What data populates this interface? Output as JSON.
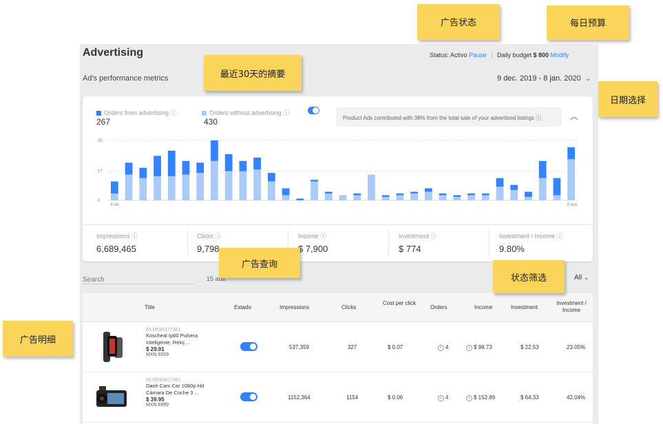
{
  "header": {
    "title": "Advertising",
    "status_label": "Status",
    "status_value": "Activo",
    "pause_link": "Pause",
    "budget_label": "Daily budget",
    "budget_value": "$ 800",
    "modify_link": "Modify"
  },
  "subtitle": "Ad's performance metrics",
  "date_range": {
    "start": "9 dec. 2019",
    "end": "8 jan. 2020"
  },
  "chart_card": {
    "legend": [
      {
        "label": "Orders from advertising",
        "value": "267",
        "color": "#3483fa"
      },
      {
        "label": "Orders without advertising",
        "value": "430",
        "color": "#aacbf7"
      }
    ],
    "info_text": "Product Ads contributed with 38% from the total sale of your advertised listings"
  },
  "chart_data": {
    "type": "bar",
    "stacked": true,
    "y_ticks": [
      "35",
      "17",
      "0"
    ],
    "ylim": [
      0,
      35
    ],
    "x_ticks": [
      "9 dic",
      "8 ene"
    ],
    "series": [
      {
        "name": "Orders from advertising",
        "color": "#3483fa",
        "values": [
          7,
          7,
          6,
          12,
          15,
          8,
          6,
          12,
          10,
          6,
          7,
          5,
          4,
          1,
          1,
          1,
          0,
          1,
          0,
          1,
          1,
          1,
          2,
          1,
          1,
          1,
          1,
          5,
          3,
          3,
          10,
          10,
          7
        ]
      },
      {
        "name": "Orders without advertising",
        "color": "#aacbf7",
        "values": [
          4,
          15,
          13,
          14,
          14,
          15,
          16,
          23,
          17,
          17,
          18,
          11,
          3,
          0,
          11,
          4,
          3,
          3,
          15,
          2,
          3,
          4,
          5,
          3,
          2,
          3,
          3,
          8,
          6,
          2,
          13,
          3,
          24
        ]
      }
    ]
  },
  "metrics": [
    {
      "label": "Impressions",
      "value": "6,689,465"
    },
    {
      "label": "Clicks",
      "value": "9,798"
    },
    {
      "label": "Income",
      "value": "$ 7,900"
    },
    {
      "label": "Investment",
      "value": "$ 774"
    },
    {
      "label": "Investment / Income",
      "value": "9.80%"
    }
  ],
  "search": {
    "placeholder": "Search",
    "result_count": "15 ads"
  },
  "filter": {
    "label": "All"
  },
  "table": {
    "columns": [
      "Title",
      "Estado",
      "Impressions",
      "Clicks",
      "Cost per click",
      "Orders",
      "Income",
      "Investment",
      "Investment / Income"
    ],
    "rows": [
      {
        "id": "MLM580177361",
        "title": "Koscheal Ip60 Pulsera Inteligente, Reloj ...",
        "price": "$ 29.91",
        "currency": "MXN 6559",
        "impressions": "537,359",
        "clicks": "327",
        "cpc": "$ 0.07",
        "orders": "4",
        "income": "$ 98.73",
        "investment": "$ 22.53",
        "ratio": "23.05%"
      },
      {
        "id": "MLM580817361",
        "title": "Dash Cam Car 1080p Hd Cámara De Coche 3 ...",
        "price": "$ 39.95",
        "currency": "MXN 6999",
        "impressions": "1152,364",
        "clicks": "1154",
        "cpc": "$ 0.06",
        "orders": "4",
        "income": "$ 152.89",
        "investment": "$ 64.33",
        "ratio": "42.04%"
      }
    ]
  },
  "callouts": {
    "ad_status": "广告状态",
    "daily_budget": "每日预算",
    "summary_30d": "最近30天的摘要",
    "date_select": "日期选择",
    "ad_query": "广告查询",
    "status_filter": "状态筛选",
    "ad_detail": "广告明细"
  }
}
